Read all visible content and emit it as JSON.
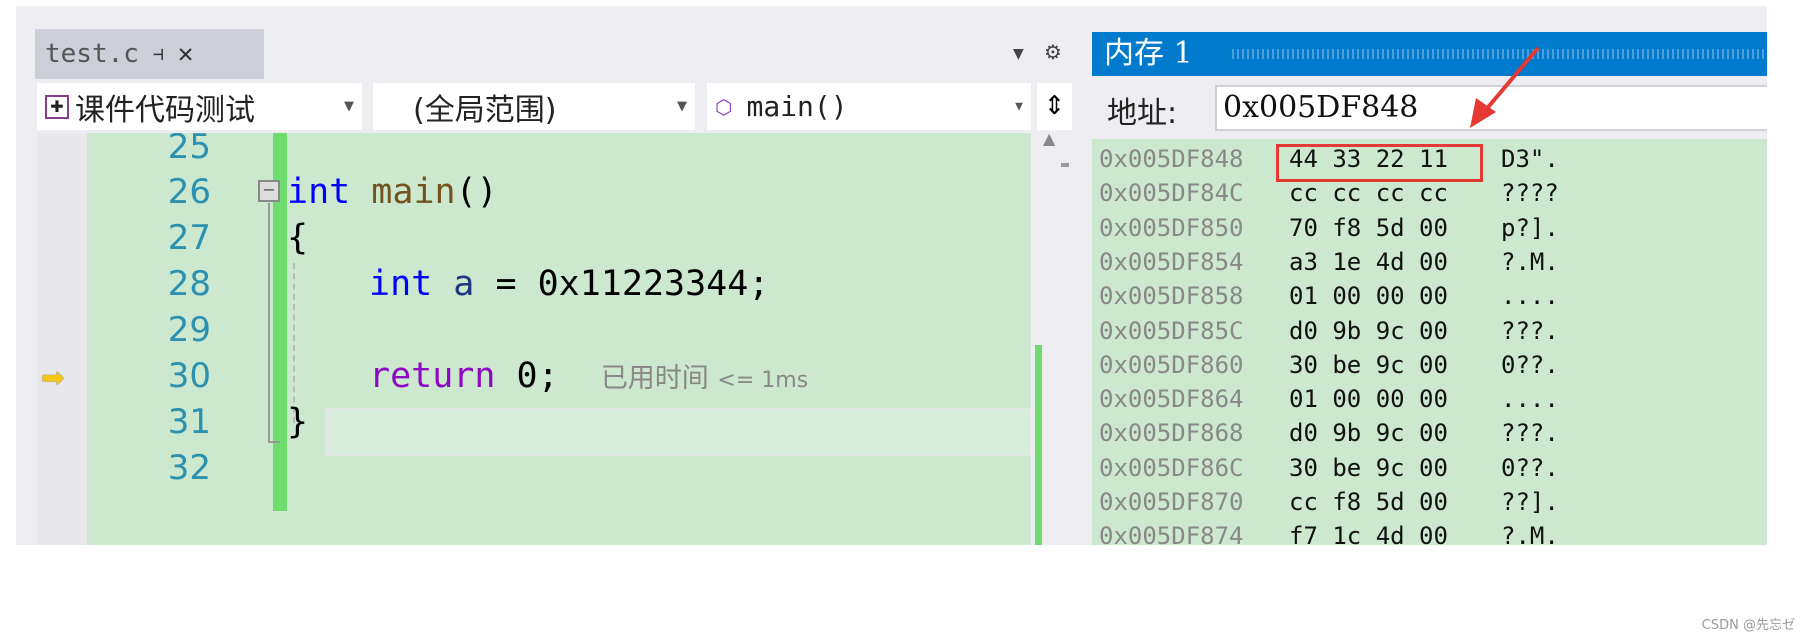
{
  "editor": {
    "tab": {
      "title": "test.c",
      "pin_icon": "pin-icon",
      "close_icon": "close-icon"
    },
    "dropdowns": {
      "project": "课件代码测试",
      "scope": "(全局范围)",
      "member": "main()"
    },
    "lines": [
      {
        "num": "25",
        "code": ""
      },
      {
        "num": "26",
        "code": "int main()"
      },
      {
        "num": "27",
        "code": "{"
      },
      {
        "num": "28",
        "code": "int a = 0x11223344;"
      },
      {
        "num": "29",
        "code": ""
      },
      {
        "num": "30",
        "code": "return 0;"
      },
      {
        "num": "31",
        "code": "}"
      },
      {
        "num": "32",
        "code": ""
      }
    ],
    "tokens": {
      "int": "int",
      "main": "main",
      "parens": "()",
      "a": "a",
      "assign": " = 0x11223344;",
      "return": "return",
      "zero": " 0;",
      "open": "{",
      "close": "}"
    },
    "elapsed_hint": "已用时间",
    "elapsed_value": "<= 1ms",
    "current_line": "30"
  },
  "memory": {
    "title": "内存 1",
    "address_label": "地址:",
    "address_value": "0x005DF848",
    "rows": [
      {
        "addr": "0x005DF848",
        "bytes": "44 33 22 11",
        "ascii": "D3\"."
      },
      {
        "addr": "0x005DF84C",
        "bytes": "cc cc cc cc",
        "ascii": "????"
      },
      {
        "addr": "0x005DF850",
        "bytes": "70 f8 5d 00",
        "ascii": "p?]."
      },
      {
        "addr": "0x005DF854",
        "bytes": "a3 1e 4d 00",
        "ascii": "?.M."
      },
      {
        "addr": "0x005DF858",
        "bytes": "01 00 00 00",
        "ascii": "...."
      },
      {
        "addr": "0x005DF85C",
        "bytes": "d0 9b 9c 00",
        "ascii": "???."
      },
      {
        "addr": "0x005DF860",
        "bytes": "30 be 9c 00",
        "ascii": "0??."
      },
      {
        "addr": "0x005DF864",
        "bytes": "01 00 00 00",
        "ascii": "...."
      },
      {
        "addr": "0x005DF868",
        "bytes": "d0 9b 9c 00",
        "ascii": "???."
      },
      {
        "addr": "0x005DF86C",
        "bytes": "30 be 9c 00",
        "ascii": "0??."
      },
      {
        "addr": "0x005DF870",
        "bytes": "cc f8 5d 00",
        "ascii": "??]."
      },
      {
        "addr": "0x005DF874",
        "bytes": "f7 1c 4d 00",
        "ascii": "?.M."
      }
    ]
  },
  "annotation": {
    "highlight_color": "#e53935"
  },
  "watermark": "CSDN @先忘ゼ",
  "colors": {
    "title_bar": "#007acc",
    "editor_bg": "#cce8cf",
    "change_bar": "#6edc6e"
  }
}
